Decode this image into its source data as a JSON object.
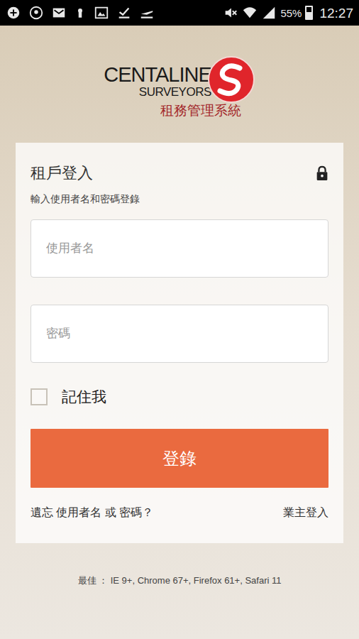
{
  "status_bar": {
    "battery": "55%",
    "battery_level": 0.55,
    "time": "12:27"
  },
  "logo": {
    "brand": "CENTALINE",
    "sub": "SURVEYORS",
    "system": "租務管理系統"
  },
  "login": {
    "title": "租戶登入",
    "subtitle": "輸入使用者名和密碼登錄",
    "username_placeholder": "使用者名",
    "password_placeholder": "密碼",
    "remember": {
      "label": "記住我",
      "checked": false
    },
    "submit": "登錄",
    "forgot": "遺忘 使用者名 或 密碼？",
    "owner_login": "業主登入"
  },
  "footer": "最佳 ： IE 9+, Chrome 67+, Firefox 61+, Safari 11"
}
